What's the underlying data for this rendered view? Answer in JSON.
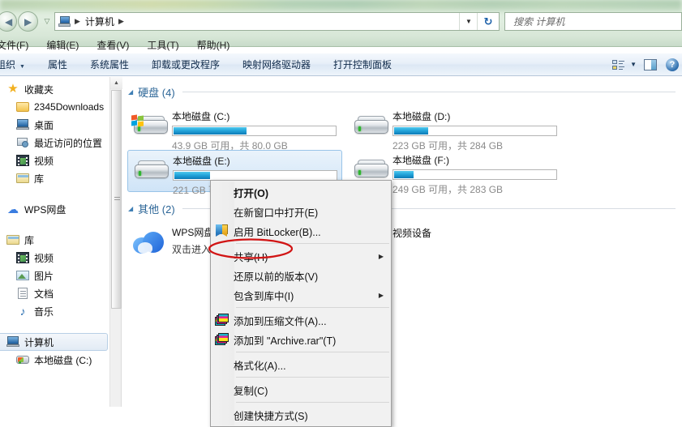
{
  "window": {
    "title_hidden": true
  },
  "navigation": {
    "back_label": "◀",
    "forward_label": "▶",
    "recent_label": "▽",
    "breadcrumb": {
      "computer": "计算机",
      "sep": "▶"
    },
    "address_dropdown": "▼",
    "refresh": "↻"
  },
  "search": {
    "placeholder": "搜索 计算机"
  },
  "menubar": {
    "items": [
      {
        "label": "文件(F)"
      },
      {
        "label": "编辑(E)"
      },
      {
        "label": "查看(V)"
      },
      {
        "label": "工具(T)"
      },
      {
        "label": "帮助(H)"
      }
    ]
  },
  "toolbar": {
    "organize": "组织",
    "organize_caret": "▼",
    "items": [
      {
        "label": "属性"
      },
      {
        "label": "系统属性"
      },
      {
        "label": "卸载或更改程序"
      },
      {
        "label": "映射网络驱动器"
      },
      {
        "label": "打开控制面板"
      }
    ],
    "view_caret": "▼",
    "help_glyph": "?"
  },
  "sidebar": {
    "groups": [
      {
        "header": {
          "label": "收藏夹",
          "icon": "star-icon"
        },
        "items": [
          {
            "label": "2345Downloads",
            "icon": "folder-icon"
          },
          {
            "label": "桌面",
            "icon": "monitor-icon"
          },
          {
            "label": "最近访问的位置",
            "icon": "recent-places-icon"
          },
          {
            "label": "视频",
            "icon": "film-icon"
          },
          {
            "label": "库",
            "icon": "library-icon"
          }
        ]
      },
      {
        "header": {
          "label": "WPS网盘",
          "icon": "cloud-icon"
        },
        "items": []
      },
      {
        "header": {
          "label": "库",
          "icon": "library-icon"
        },
        "items": [
          {
            "label": "视频",
            "icon": "film-icon"
          },
          {
            "label": "图片",
            "icon": "picture-icon"
          },
          {
            "label": "文档",
            "icon": "document-icon"
          },
          {
            "label": "音乐",
            "icon": "music-icon"
          }
        ]
      },
      {
        "header": {
          "label": "计算机",
          "icon": "computer-icon",
          "selected": true
        },
        "items": [
          {
            "label": "本地磁盘 (C:)",
            "icon": "harddisk-win-icon"
          }
        ]
      }
    ],
    "scrollbar": {
      "up_arrow": "▲"
    }
  },
  "content": {
    "groups": [
      {
        "title": "硬盘 (4)",
        "triangle": "◢",
        "drives": [
          {
            "name": "本地磁盘 (C:)",
            "size_text": "43.9 GB 可用，共 80.0 GB",
            "used_pct": 45,
            "selected": false,
            "has_win_flag": true
          },
          {
            "name": "本地磁盘 (D:)",
            "size_text": "223 GB 可用，共 284 GB",
            "used_pct": 21,
            "selected": false,
            "has_win_flag": false
          },
          {
            "name": "本地磁盘 (E:)",
            "size_text": "221 GB 可用，共 284 GB",
            "used_pct": 22,
            "selected": true,
            "has_win_flag": false
          },
          {
            "name": "本地磁盘 (F:)",
            "size_text": "249 GB 可用，共 283 GB",
            "used_pct": 12,
            "selected": false,
            "has_win_flag": false
          }
        ]
      },
      {
        "title": "其他 (2)",
        "triangle": "◢",
        "items": [
          {
            "name": "WPS网盘",
            "desc": "双击进入",
            "icon": "wps-cloud-icon"
          },
          {
            "name": "视频设备",
            "desc": "",
            "icon": "video-device-icon"
          }
        ]
      }
    ]
  },
  "context_menu": {
    "rows": [
      {
        "label": "打开(O)",
        "bold": true,
        "icon": null,
        "submenu": false,
        "sep_after": false
      },
      {
        "label": "在新窗口中打开(E)",
        "bold": false,
        "icon": null,
        "submenu": false,
        "sep_after": false
      },
      {
        "label": "启用 BitLocker(B)...",
        "bold": false,
        "icon": "shield-icon",
        "submenu": false,
        "sep_after": true
      },
      {
        "label": "共享(H)",
        "bold": false,
        "icon": null,
        "submenu": true,
        "sep_after": false,
        "annotated": true
      },
      {
        "label": "还原以前的版本(V)",
        "bold": false,
        "icon": null,
        "submenu": false,
        "sep_after": false
      },
      {
        "label": "包含到库中(I)",
        "bold": false,
        "icon": null,
        "submenu": true,
        "sep_after": true
      },
      {
        "label": "添加到压缩文件(A)...",
        "bold": false,
        "icon": "winrar-icon",
        "submenu": false,
        "sep_after": false
      },
      {
        "label": "添加到 \"Archive.rar\"(T)",
        "bold": false,
        "icon": "winrar-icon",
        "submenu": false,
        "sep_after": true
      },
      {
        "label": "格式化(A)...",
        "bold": false,
        "icon": null,
        "submenu": false,
        "sep_after": true
      },
      {
        "label": "复制(C)",
        "bold": false,
        "icon": null,
        "submenu": false,
        "sep_after": true
      },
      {
        "label": "创建快捷方式(S)",
        "bold": false,
        "icon": null,
        "submenu": false,
        "sep_after": false
      }
    ],
    "submenu_arrow": "▶"
  },
  "annotation": {
    "shape": "ellipse",
    "color": "#d11414",
    "target": "共享(H)"
  },
  "colors": {
    "accent_blue": "#2a6496",
    "bar_fill": "#0d7ab6",
    "glass_green": "#cde2cd",
    "selection": "#cfe4f7",
    "annotation_red": "#d11414"
  }
}
